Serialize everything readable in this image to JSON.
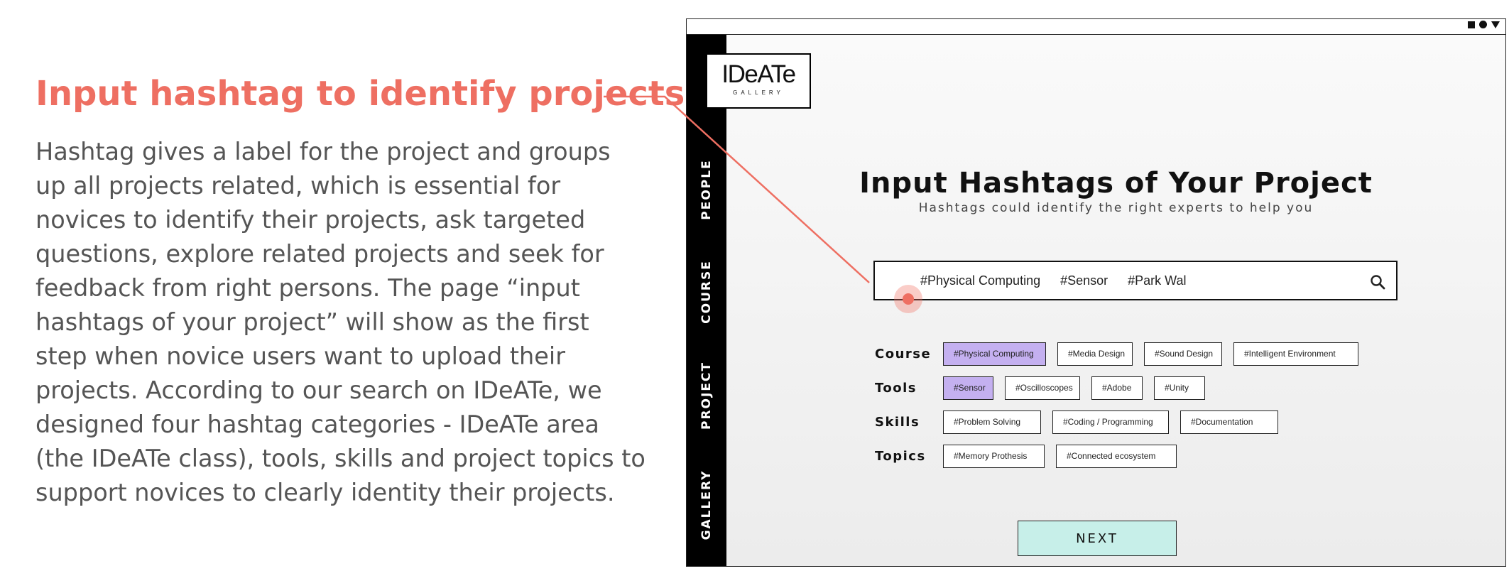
{
  "annotation": {
    "title": "Input hashtag to identify projects",
    "body": "Hashtag gives a label for the project and groups up all projects related, which is essential for novices to identify their projects, ask targeted questions, explore related projects and seek for feedback from right persons. The page “input hashtags of your project” will show as the first step when novice users want to upload their projects. According to our search on IDeATe, we designed four hashtag categories - IDeATe area (the IDeATe class), tools, skills and project topics to support novices to clearly identity their projects."
  },
  "colors": {
    "accent": "#ee6f62",
    "selected_chip": "#c4b0f0",
    "next_button": "#c7efe9",
    "sidebar": "#000000"
  },
  "window_controls": [
    "square-icon",
    "circle-icon",
    "triangle-down-icon"
  ],
  "logo": {
    "main": "IDeATe",
    "sub": "GALLERY"
  },
  "sidebar": {
    "items": [
      {
        "label": "PEOPLE"
      },
      {
        "label": "COURSE"
      },
      {
        "label": "PROJECT"
      },
      {
        "label": "GALLERY"
      }
    ]
  },
  "page": {
    "title": "Input Hashtags of Your Project",
    "subtitle": "Hashtags could identify the right experts to help you"
  },
  "search": {
    "tags": [
      "#Physical Computing",
      "#Sensor",
      "#Park Wal"
    ],
    "icon": "search-icon"
  },
  "categories": [
    {
      "label": "Course",
      "chips": [
        {
          "text": "#Physical Computing",
          "selected": true
        },
        {
          "text": "#Media Design",
          "selected": false
        },
        {
          "text": "#Sound Design",
          "selected": false
        },
        {
          "text": "#Intelligent Environment",
          "selected": false
        }
      ]
    },
    {
      "label": "Tools",
      "chips": [
        {
          "text": "#Sensor",
          "selected": true
        },
        {
          "text": "#Oscilloscopes",
          "selected": false
        },
        {
          "text": "#Adobe",
          "selected": false
        },
        {
          "text": "#Unity",
          "selected": false
        }
      ]
    },
    {
      "label": "Skills",
      "chips": [
        {
          "text": "#Problem Solving",
          "selected": false
        },
        {
          "text": "#Coding / Programming",
          "selected": false
        },
        {
          "text": "#Documentation",
          "selected": false
        }
      ]
    },
    {
      "label": "Topics",
      "chips": [
        {
          "text": "#Memory Prothesis",
          "selected": false
        },
        {
          "text": "#Connected ecosystem",
          "selected": false
        }
      ]
    }
  ],
  "next_button": {
    "label": "NEXT"
  }
}
